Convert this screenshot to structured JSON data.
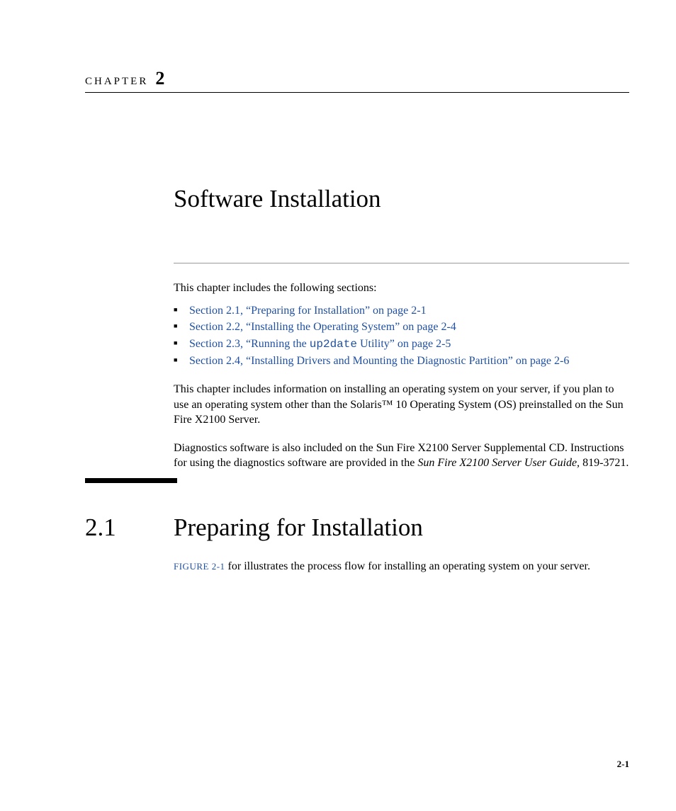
{
  "chapter": {
    "label": "CHAPTER",
    "number": "2",
    "title": "Software Installation"
  },
  "intro": {
    "lead": "This chapter includes the following sections:",
    "toc": [
      {
        "prefix": "Section 2.1, “Preparing for Installation” on page 2-1"
      },
      {
        "prefix": "Section 2.2, “Installing the Operating System” on page 2-4"
      },
      {
        "prefix_a": "Section 2.3, “Running the ",
        "mono": "up2date",
        "prefix_b": " Utility” on page 2-5"
      },
      {
        "prefix": "Section 2.4, “Installing Drivers and Mounting the Diagnostic Partition” on page 2-6"
      }
    ],
    "para1": "This chapter includes information on installing an operating system on your server, if you plan to use an operating system other than the Solaris™ 10 Operating System (OS) preinstalled on the Sun Fire X2100 Server.",
    "para2_a": "Diagnostics software is also included on the Sun Fire X2100 Server Supplemental CD. Instructions for using the diagnostics software are provided in the ",
    "para2_italic": "Sun Fire X2100 Server User Guide,",
    "para2_b": " 819-3721."
  },
  "section": {
    "number": "2.1",
    "title": "Preparing for Installation",
    "figure_ref": "FIGURE 2-1",
    "body": " for illustrates the process flow for installing an operating system on your server."
  },
  "footer": {
    "page": "2-1"
  }
}
